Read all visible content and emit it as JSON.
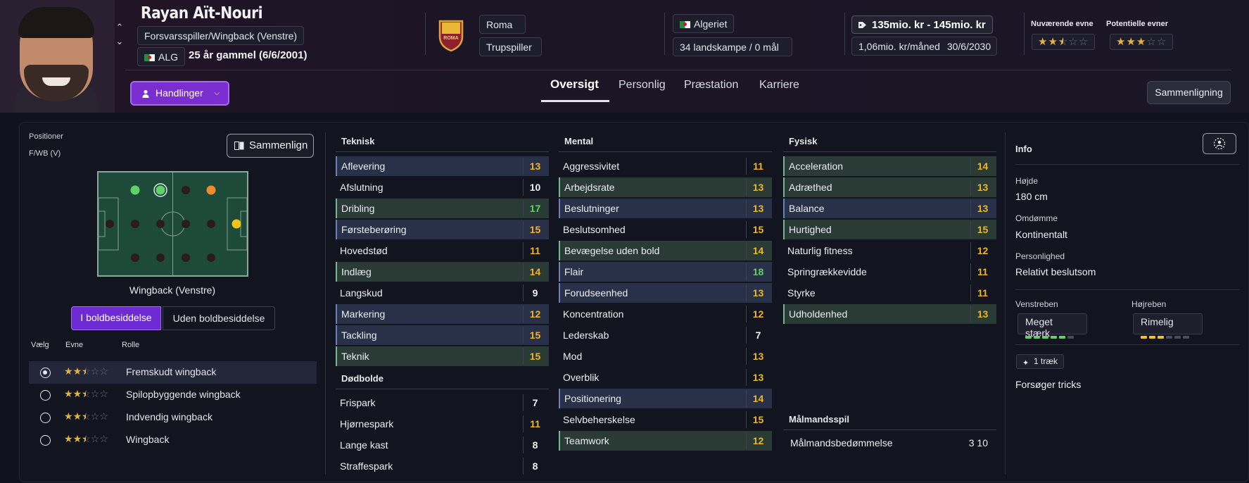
{
  "player": {
    "name": "Rayan Aït-Nouri",
    "position": "Forsvarsspiller/Wingback (Venstre)",
    "nation_code": "ALG",
    "age": "25 år gammel (6/6/2001)"
  },
  "club": {
    "name": "Roma",
    "status": "Trupspiller",
    "logo_text": "ROMA"
  },
  "nation": {
    "name": "Algeriet",
    "caps": "34 landskampe / 0 mål"
  },
  "contract": {
    "value": "135mio. kr - 145mio. kr",
    "wage": "1,06mio. kr/måned",
    "expiry": "30/6/2030"
  },
  "ability": {
    "current_label": "Nuværende evne",
    "potential_label": "Potentielle evner",
    "current_stars": 2.5,
    "potential_stars": 3
  },
  "actions_label": "Handlinger",
  "tabs": [
    {
      "label": "Oversigt",
      "active": true
    },
    {
      "label": "Personlig",
      "active": false
    },
    {
      "label": "Præstation",
      "active": false
    },
    {
      "label": "Karriere",
      "active": false
    }
  ],
  "compare_label": "Sammenligning",
  "positions": {
    "label": "Positioner",
    "value": "F/WB (V)",
    "compare_label": "Sammenlign",
    "current": "Wingback (Venstre)",
    "seg_in": "I boldbesiddelse",
    "seg_out": "Uden boldbesiddelse",
    "col_select": "Vælg",
    "col_ability": "Evne",
    "col_role": "Rolle",
    "roles": [
      {
        "name": "Fremskudt wingback",
        "stars": 2.5,
        "selected": true
      },
      {
        "name": "Spilopbyggende wingback",
        "stars": 2.5,
        "selected": false
      },
      {
        "name": "Indvendig wingback",
        "stars": 2.5,
        "selected": false
      },
      {
        "name": "Wingback",
        "stars": 2.5,
        "selected": false
      }
    ]
  },
  "technical": {
    "title": "Teknisk",
    "items": [
      {
        "name": "Aflevering",
        "value": 13,
        "hl": "blue"
      },
      {
        "name": "Afslutning",
        "value": 10,
        "hl": ""
      },
      {
        "name": "Dribling",
        "value": 17,
        "hl": "green"
      },
      {
        "name": "Førsteberøring",
        "value": 15,
        "hl": "blue"
      },
      {
        "name": "Hovedstød",
        "value": 11,
        "hl": ""
      },
      {
        "name": "Indlæg",
        "value": 14,
        "hl": "green"
      },
      {
        "name": "Langskud",
        "value": 9,
        "hl": ""
      },
      {
        "name": "Markering",
        "value": 12,
        "hl": "blue"
      },
      {
        "name": "Tackling",
        "value": 15,
        "hl": "blue"
      },
      {
        "name": "Teknik",
        "value": 15,
        "hl": "green"
      }
    ]
  },
  "set_pieces": {
    "title": "Dødbolde",
    "items": [
      {
        "name": "Frispark",
        "value": 7,
        "hl": ""
      },
      {
        "name": "Hjørnespark",
        "value": 11,
        "hl": ""
      },
      {
        "name": "Lange kast",
        "value": 8,
        "hl": ""
      },
      {
        "name": "Straffespark",
        "value": 8,
        "hl": ""
      }
    ]
  },
  "mental": {
    "title": "Mental",
    "items": [
      {
        "name": "Aggressivitet",
        "value": 11,
        "hl": ""
      },
      {
        "name": "Arbejdsrate",
        "value": 13,
        "hl": "green"
      },
      {
        "name": "Beslutninger",
        "value": 13,
        "hl": "blue"
      },
      {
        "name": "Beslutsomhed",
        "value": 15,
        "hl": ""
      },
      {
        "name": "Bevægelse uden bold",
        "value": 14,
        "hl": "green"
      },
      {
        "name": "Flair",
        "value": 18,
        "hl": "blue"
      },
      {
        "name": "Forudseenhed",
        "value": 13,
        "hl": "blue"
      },
      {
        "name": "Koncentration",
        "value": 12,
        "hl": ""
      },
      {
        "name": "Lederskab",
        "value": 7,
        "hl": ""
      },
      {
        "name": "Mod",
        "value": 13,
        "hl": ""
      },
      {
        "name": "Overblik",
        "value": 13,
        "hl": ""
      },
      {
        "name": "Positionering",
        "value": 14,
        "hl": "blue"
      },
      {
        "name": "Selvbeherskelse",
        "value": 15,
        "hl": ""
      },
      {
        "name": "Teamwork",
        "value": 12,
        "hl": "green"
      }
    ]
  },
  "physical": {
    "title": "Fysisk",
    "items": [
      {
        "name": "Acceleration",
        "value": 14,
        "hl": "green"
      },
      {
        "name": "Adræthed",
        "value": 13,
        "hl": "green"
      },
      {
        "name": "Balance",
        "value": 13,
        "hl": "blue"
      },
      {
        "name": "Hurtighed",
        "value": 15,
        "hl": "green"
      },
      {
        "name": "Naturlig fitness",
        "value": 12,
        "hl": ""
      },
      {
        "name": "Springrækkevidde",
        "value": 11,
        "hl": ""
      },
      {
        "name": "Styrke",
        "value": 11,
        "hl": ""
      },
      {
        "name": "Udholdenhed",
        "value": 13,
        "hl": "green"
      }
    ]
  },
  "goalkeeping": {
    "title": "Målmandsspil",
    "label": "Målmandsbedømmelse",
    "value": "3 10"
  },
  "info": {
    "title": "Info",
    "height_label": "Højde",
    "height": "180 cm",
    "reputation_label": "Omdømme",
    "reputation": "Kontinentalt",
    "personality_label": "Personlighed",
    "personality": "Relativt beslutsom",
    "left_foot_label": "Venstreben",
    "left_foot": "Meget stærk",
    "left_foot_level": 5,
    "right_foot_label": "Højreben",
    "right_foot": "Rimelig",
    "right_foot_level": 3,
    "traits_chip": "1 træk",
    "trait": "Forsøger tricks"
  },
  "colors": {
    "accent": "#7a2ed0",
    "value_yellow": "#f0b429",
    "value_green": "#5fd16a",
    "foot_strong": "#5fd16a",
    "foot_fair": "#f0c419"
  }
}
